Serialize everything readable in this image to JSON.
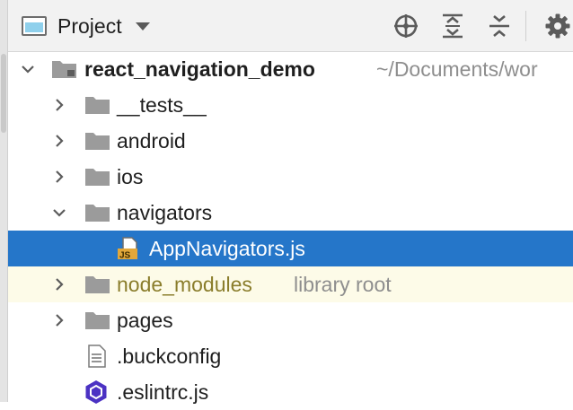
{
  "toolbar": {
    "view_title": "Project",
    "icons": [
      "locate-icon",
      "expand-all-icon",
      "collapse-all-icon",
      "settings-icon"
    ]
  },
  "tree": {
    "root": {
      "name": "react_navigation_demo",
      "path": "~/Documents/wor"
    },
    "items": [
      {
        "label": "__tests__"
      },
      {
        "label": "android"
      },
      {
        "label": "ios"
      },
      {
        "label": "navigators"
      },
      {
        "label": "AppNavigators.js",
        "file_badge": "JS"
      },
      {
        "label": "node_modules",
        "hint": "library root"
      },
      {
        "label": "pages"
      },
      {
        "label": ".buckconfig"
      },
      {
        "label": ".eslintrc.js"
      }
    ]
  },
  "colors": {
    "selection": "#2576c9",
    "library_bg": "#fdfbe8",
    "library_text": "#8a7d2b",
    "folder": "#9b9b9b",
    "js_badge": "#e2a73a",
    "eslint": "#4b32c3"
  }
}
